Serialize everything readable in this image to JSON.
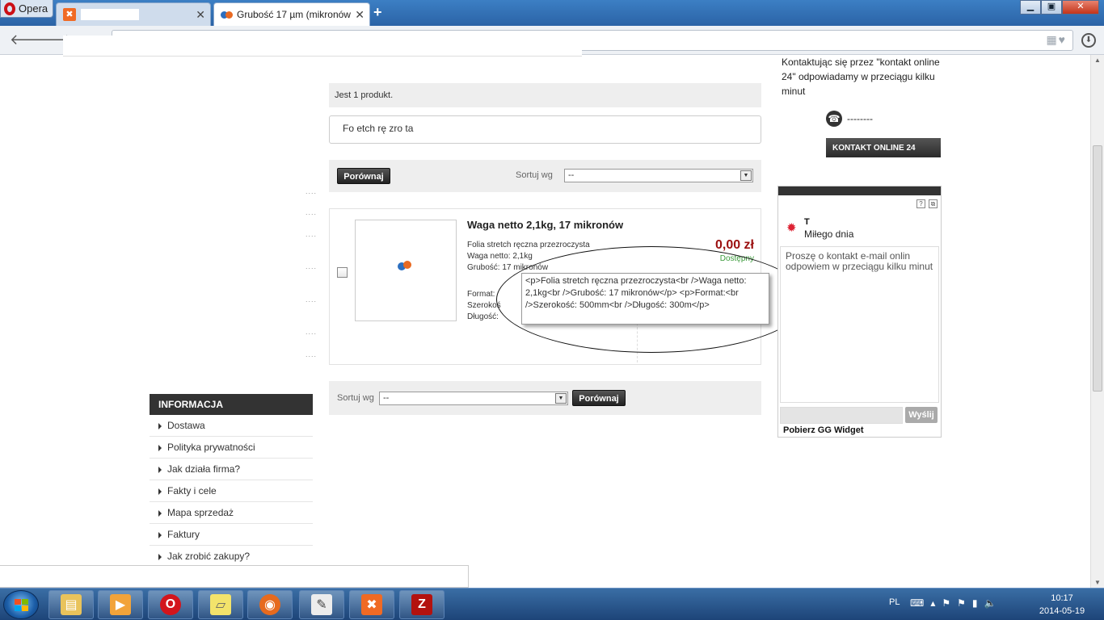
{
  "browser": {
    "app_label": "Opera",
    "tabs": [
      {
        "title": ""
      },
      {
        "title": "Grubość 17 µm (mikronów"
      }
    ],
    "new_tab": "+",
    "close_glyph": "✕",
    "window_buttons": [
      "▁",
      "▣",
      "✕"
    ]
  },
  "listing": {
    "count_text": "Jest 1 produkt.",
    "search_fragment": "Fo         etch rę               zro        ta",
    "compare_label": "Porównaj",
    "sort_label": "Sortuj wg",
    "sort_value": "--"
  },
  "product": {
    "name": "Waga netto 2,1kg, 17 mikronów",
    "desc_lines": [
      "Folia stretch ręczna przezroczysta",
      "Waga netto: 2,1kg",
      "Grubość: 17 mikronów"
    ],
    "desc2_lines": [
      "Format:",
      "Szerokość: 500mm",
      "Długość: 300m"
    ],
    "price": "0,00 zł",
    "availability": "Dostępny"
  },
  "tooltip": {
    "text": "<p>Folia stretch ręczna przezroczysta<br />Waga netto: 2,1kg<br />Grubość: 17 mikronów</p>\n<p>Format:<br />Szerokość: 500mm<br />Długość: 300m</p>"
  },
  "info_menu": {
    "header": "INFORMACJA",
    "items": [
      "Dostawa",
      "Polityka prywatności",
      "Jak działa firma?",
      "Fakty i cele",
      "Mapa sprzedaż",
      "Faktury",
      "Jak zrobić zakupy?"
    ]
  },
  "contact": {
    "text": "Kontaktując się przez \"kontakt online 24\" odpowiadamy w przeciągu kilku minut",
    "phone": "--------",
    "button": "KONTAKT ONLINE 24"
  },
  "gg_widget": {
    "user": "T",
    "status": "Miłego dnia",
    "message": "Proszę o kontakt e-mail onlin                odpowiem w przeciągu kilku minut",
    "send": "Wyślij",
    "footer": "Pobierz GG Widget",
    "mini_icons": [
      "?",
      "⧉"
    ]
  },
  "taskbar": {
    "lang": "PL",
    "time": "10:17",
    "date": "2014-05-19",
    "apps": [
      "explorer-icon",
      "media-player-icon",
      "opera-icon",
      "sticky-notes-icon",
      "firefox-icon",
      "notepad-icon",
      "xampp-icon",
      "filezilla-icon"
    ]
  },
  "colors": {
    "price": "#9b1010",
    "available": "#3a9a3a",
    "taskbar": "#1d4478"
  }
}
